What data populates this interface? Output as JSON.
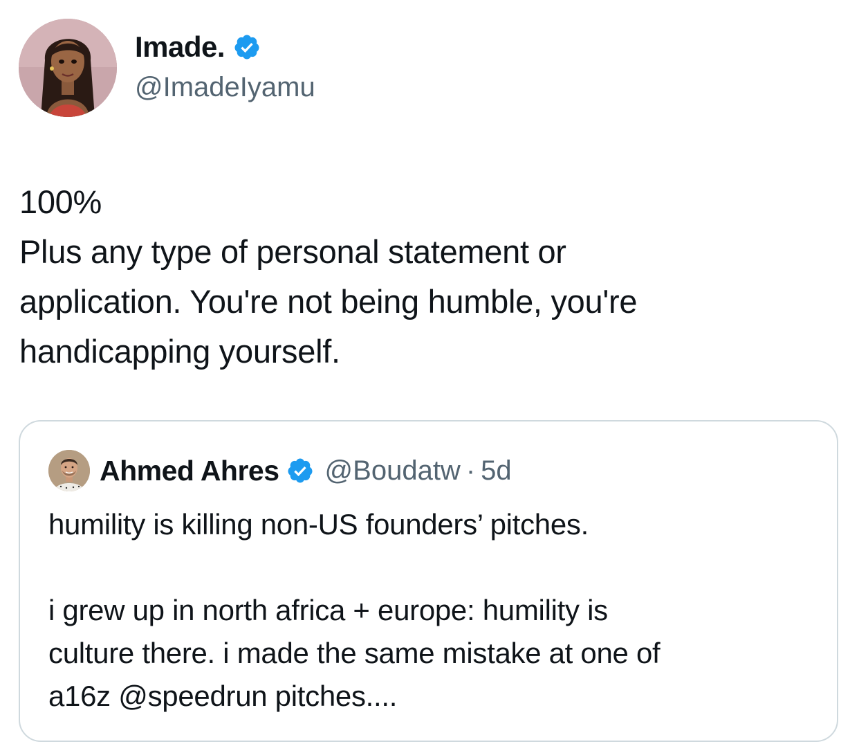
{
  "author": {
    "display_name": "Imade.",
    "handle": "@ImadeIyamu",
    "verified": true,
    "avatar_icon": "avatar-illustration"
  },
  "tweet": {
    "lines": [
      "100%",
      "Plus any type of personal statement or",
      "application. You're not being humble, you're",
      "handicapping yourself."
    ]
  },
  "quoted_tweet": {
    "display_name": "Ahmed Ahres",
    "handle": "@Boudatw",
    "separator": "·",
    "time": "5d",
    "verified": true,
    "lines": [
      "humility is killing non-US founders’ pitches.",
      "",
      "i grew up in north africa + europe: humility is",
      "culture there. i made the same mistake at one of",
      "a16z @speedrun pitches...."
    ]
  },
  "colors": {
    "text_primary": "#0f1419",
    "text_secondary": "#536471",
    "verified_blue": "#1d9bf0",
    "border": "#cfd9de"
  }
}
